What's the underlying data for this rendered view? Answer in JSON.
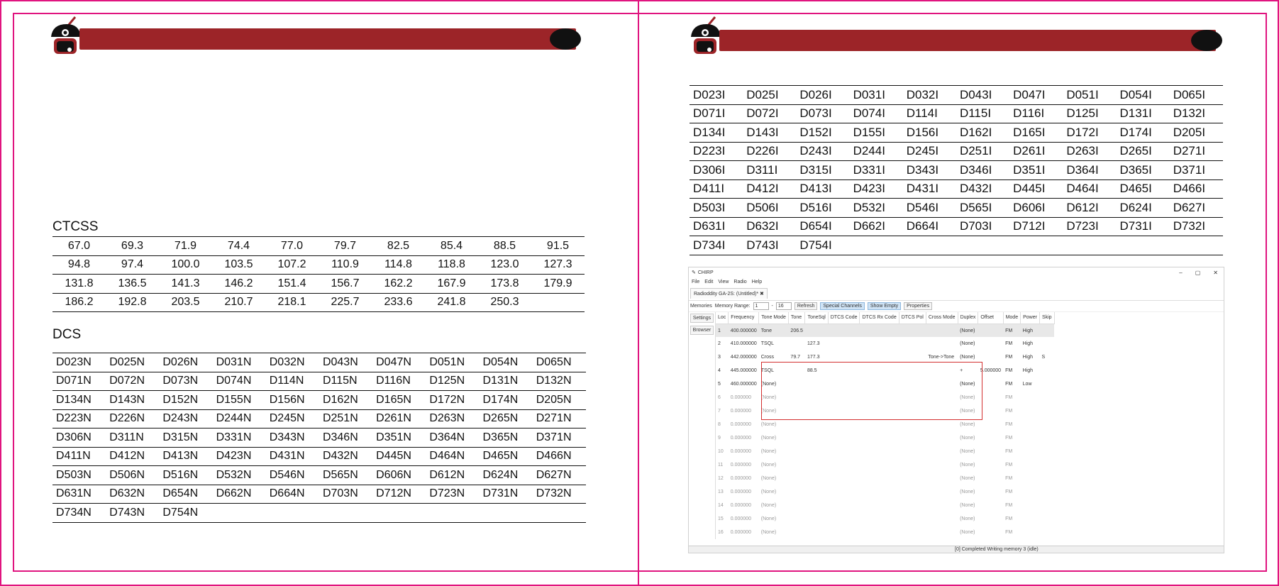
{
  "left_page": {
    "ctcss": {
      "title": "CTCSS",
      "rows": [
        [
          "67.0",
          "69.3",
          "71.9",
          "74.4",
          "77.0",
          "79.7",
          "82.5",
          "85.4",
          "88.5",
          "91.5"
        ],
        [
          "94.8",
          "97.4",
          "100.0",
          "103.5",
          "107.2",
          "110.9",
          "114.8",
          "118.8",
          "123.0",
          "127.3"
        ],
        [
          "131.8",
          "136.5",
          "141.3",
          "146.2",
          "151.4",
          "156.7",
          "162.2",
          "167.9",
          "173.8",
          "179.9"
        ],
        [
          "186.2",
          "192.8",
          "203.5",
          "210.7",
          "218.1",
          "225.7",
          "233.6",
          "241.8",
          "250.3",
          ""
        ]
      ]
    },
    "dcs": {
      "title": "DCS",
      "rows": [
        [
          "D023N",
          "D025N",
          "D026N",
          "D031N",
          "D032N",
          "D043N",
          "D047N",
          "D051N",
          "D054N",
          "D065N"
        ],
        [
          "D071N",
          "D072N",
          "D073N",
          "D074N",
          "D114N",
          "D115N",
          "D116N",
          "D125N",
          "D131N",
          "D132N"
        ],
        [
          "D134N",
          "D143N",
          "D152N",
          "D155N",
          "D156N",
          "D162N",
          "D165N",
          "D172N",
          "D174N",
          "D205N"
        ],
        [
          "D223N",
          "D226N",
          "D243N",
          "D244N",
          "D245N",
          "D251N",
          "D261N",
          "D263N",
          "D265N",
          "D271N"
        ],
        [
          "D306N",
          "D311N",
          "D315N",
          "D331N",
          "D343N",
          "D346N",
          "D351N",
          "D364N",
          "D365N",
          "D371N"
        ],
        [
          "D411N",
          "D412N",
          "D413N",
          "D423N",
          "D431N",
          "D432N",
          "D445N",
          "D464N",
          "D465N",
          "D466N"
        ],
        [
          "D503N",
          "D506N",
          "D516N",
          "D532N",
          "D546N",
          "D565N",
          "D606N",
          "D612N",
          "D624N",
          "D627N"
        ],
        [
          "D631N",
          "D632N",
          "D654N",
          "D662N",
          "D664N",
          "D703N",
          "D712N",
          "D723N",
          "D731N",
          "D732N"
        ],
        [
          "D734N",
          "D743N",
          "D754N",
          "",
          "",
          "",
          "",
          "",
          "",
          ""
        ]
      ]
    }
  },
  "right_page": {
    "dcs_inverted": {
      "rows": [
        [
          "D023I",
          "D025I",
          "D026I",
          "D031I",
          "D032I",
          "D043I",
          "D047I",
          "D051I",
          "D054I",
          "D065I"
        ],
        [
          "D071I",
          "D072I",
          "D073I",
          "D074I",
          "D114I",
          "D115I",
          "D116I",
          "D125I",
          "D131I",
          "D132I"
        ],
        [
          "D134I",
          "D143I",
          "D152I",
          "D155I",
          "D156I",
          "D162I",
          "D165I",
          "D172I",
          "D174I",
          "D205I"
        ],
        [
          "D223I",
          "D226I",
          "D243I",
          "D244I",
          "D245I",
          "D251I",
          "D261I",
          "D263I",
          "D265I",
          "D271I"
        ],
        [
          "D306I",
          "D311I",
          "D315I",
          "D331I",
          "D343I",
          "D346I",
          "D351I",
          "D364I",
          "D365I",
          "D371I"
        ],
        [
          "D411I",
          "D412I",
          "D413I",
          "D423I",
          "D431I",
          "D432I",
          "D445I",
          "D464I",
          "D465I",
          "D466I"
        ],
        [
          "D503I",
          "D506I",
          "D516I",
          "D532I",
          "D546I",
          "D565I",
          "D606I",
          "D612I",
          "D624I",
          "D627I"
        ],
        [
          "D631I",
          "D632I",
          "D654I",
          "D662I",
          "D664I",
          "D703I",
          "D712I",
          "D723I",
          "D731I",
          "D732I"
        ],
        [
          "D734I",
          "D743I",
          "D754I",
          "",
          "",
          "",
          "",
          "",
          "",
          ""
        ]
      ]
    },
    "chirp": {
      "window_title": "CHIRP",
      "window_controls": [
        "–",
        "▢",
        "✕"
      ],
      "menu": [
        "File",
        "Edit",
        "View",
        "Radio",
        "Help"
      ],
      "doc_tab": "Radioddity GA-2S: (Untitled)*",
      "toolbar": {
        "memories_label": "Memories",
        "range_label": "Memory Range:",
        "range_from": "1",
        "range_to": "16",
        "refresh": "Refresh",
        "special_channels": "Special Channels",
        "show_empty": "Show Empty",
        "properties": "Properties"
      },
      "side_tabs": [
        "Settings",
        "Browser"
      ],
      "columns": [
        "Loc",
        "Frequency",
        "Tone Mode",
        "Tone",
        "ToneSql",
        "DTCS Code",
        "DTCS Rx Code",
        "DTCS Pol",
        "Cross Mode",
        "Duplex",
        "Offset",
        "Mode",
        "Power",
        "Skip"
      ],
      "rows": [
        [
          "1",
          "400.000000",
          "Tone",
          "206.5",
          "",
          "",
          "",
          "",
          "",
          "(None)",
          "",
          "FM",
          "High",
          ""
        ],
        [
          "2",
          "410.000000",
          "TSQL",
          "",
          "127.3",
          "",
          "",
          "",
          "",
          "(None)",
          "",
          "FM",
          "High",
          ""
        ],
        [
          "3",
          "442.000000",
          "Cross",
          "79.7",
          "177.3",
          "",
          "",
          "",
          "Tone->Tone",
          "(None)",
          "",
          "FM",
          "High",
          "S"
        ],
        [
          "4",
          "445.000000",
          "TSQL",
          "",
          "88.5",
          "",
          "",
          "",
          "",
          "+",
          "5.000000",
          "FM",
          "High",
          ""
        ],
        [
          "5",
          "460.000000",
          "(None)",
          "",
          "",
          "",
          "",
          "",
          "",
          "(None)",
          "",
          "FM",
          "Low",
          ""
        ],
        [
          "6",
          "0.000000",
          "(None)",
          "",
          "",
          "",
          "",
          "",
          "",
          "(None)",
          "",
          "FM",
          "",
          ""
        ],
        [
          "7",
          "0.000000",
          "(None)",
          "",
          "",
          "",
          "",
          "",
          "",
          "(None)",
          "",
          "FM",
          "",
          ""
        ],
        [
          "8",
          "0.000000",
          "(None)",
          "",
          "",
          "",
          "",
          "",
          "",
          "(None)",
          "",
          "FM",
          "",
          ""
        ],
        [
          "9",
          "0.000000",
          "(None)",
          "",
          "",
          "",
          "",
          "",
          "",
          "(None)",
          "",
          "FM",
          "",
          ""
        ],
        [
          "10",
          "0.000000",
          "(None)",
          "",
          "",
          "",
          "",
          "",
          "",
          "(None)",
          "",
          "FM",
          "",
          ""
        ],
        [
          "11",
          "0.000000",
          "(None)",
          "",
          "",
          "",
          "",
          "",
          "",
          "(None)",
          "",
          "FM",
          "",
          ""
        ],
        [
          "12",
          "0.000000",
          "(None)",
          "",
          "",
          "",
          "",
          "",
          "",
          "(None)",
          "",
          "FM",
          "",
          ""
        ],
        [
          "13",
          "0.000000",
          "(None)",
          "",
          "",
          "",
          "",
          "",
          "",
          "(None)",
          "",
          "FM",
          "",
          ""
        ],
        [
          "14",
          "0.000000",
          "(None)",
          "",
          "",
          "",
          "",
          "",
          "",
          "(None)",
          "",
          "FM",
          "",
          ""
        ],
        [
          "15",
          "0.000000",
          "(None)",
          "",
          "",
          "",
          "",
          "",
          "",
          "(None)",
          "",
          "FM",
          "",
          ""
        ],
        [
          "16",
          "0.000000",
          "(None)",
          "",
          "",
          "",
          "",
          "",
          "",
          "(None)",
          "",
          "FM",
          "",
          ""
        ]
      ],
      "status": "[0] Completed Writing memory 3 (idle)"
    }
  },
  "colors": {
    "trim": "#e0147f",
    "banner": "#9c2428"
  }
}
